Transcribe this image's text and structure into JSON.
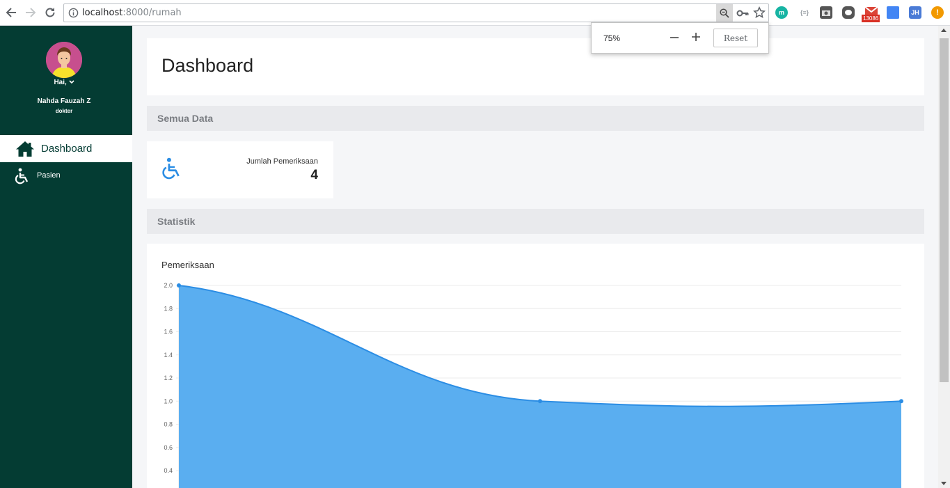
{
  "browser": {
    "url_host": "localhost",
    "url_rest": ":8000/rumah",
    "extensions": [
      {
        "icon": "m-extension-icon",
        "label": "m",
        "color": "#17b4a3"
      },
      {
        "icon": "json-extension-icon",
        "label": "{≡}",
        "color": "#9aa0a6"
      },
      {
        "icon": "camera-extension-icon",
        "label": "",
        "color": "#555555"
      },
      {
        "icon": "line-extension-icon",
        "label": "",
        "color": "#555555"
      },
      {
        "icon": "gmail-extension-icon",
        "label": "13086",
        "color": "#db4437"
      },
      {
        "icon": "blue-extension-icon",
        "label": "",
        "color": "#4285f4"
      },
      {
        "icon": "jh-extension-icon",
        "label": "JH",
        "color": "#4a7bd6"
      },
      {
        "icon": "alert-extension-icon",
        "label": "!",
        "color": "#f29900"
      }
    ]
  },
  "zoom_popup": {
    "value": "75%",
    "minus": "—",
    "plus": "+",
    "reset": "Reset"
  },
  "sidebar": {
    "greeting": "Hai,",
    "user_name": "Nahda Fauzah Z",
    "user_role": "dokter",
    "items": [
      {
        "label": "Dashboard",
        "icon": "home-icon",
        "active": true
      },
      {
        "label": "Pasien",
        "icon": "wheelchair-icon",
        "active": false
      }
    ]
  },
  "main": {
    "title": "Dashboard",
    "section_all": "Semua Data",
    "stat": {
      "label": "Jumlah Pemeriksaan",
      "value": "4",
      "icon": "wheelchair-icon"
    },
    "section_stats": "Statistik",
    "chart_title": "Pemeriksaan"
  },
  "colors": {
    "sidebar": "#043c33",
    "accent": "#2b8de4",
    "area_fill": "#5aaef0"
  },
  "chart_data": {
    "type": "area",
    "title": "Pemeriksaan",
    "x": [
      0,
      1,
      2
    ],
    "values": [
      2,
      1,
      1
    ],
    "ylim": [
      0.4,
      2.0
    ],
    "yticks": [
      "2.0",
      "1.8",
      "1.6",
      "1.4",
      "1.2",
      "1.0",
      "0.8",
      "0.6",
      "0.4"
    ],
    "grid": true
  }
}
